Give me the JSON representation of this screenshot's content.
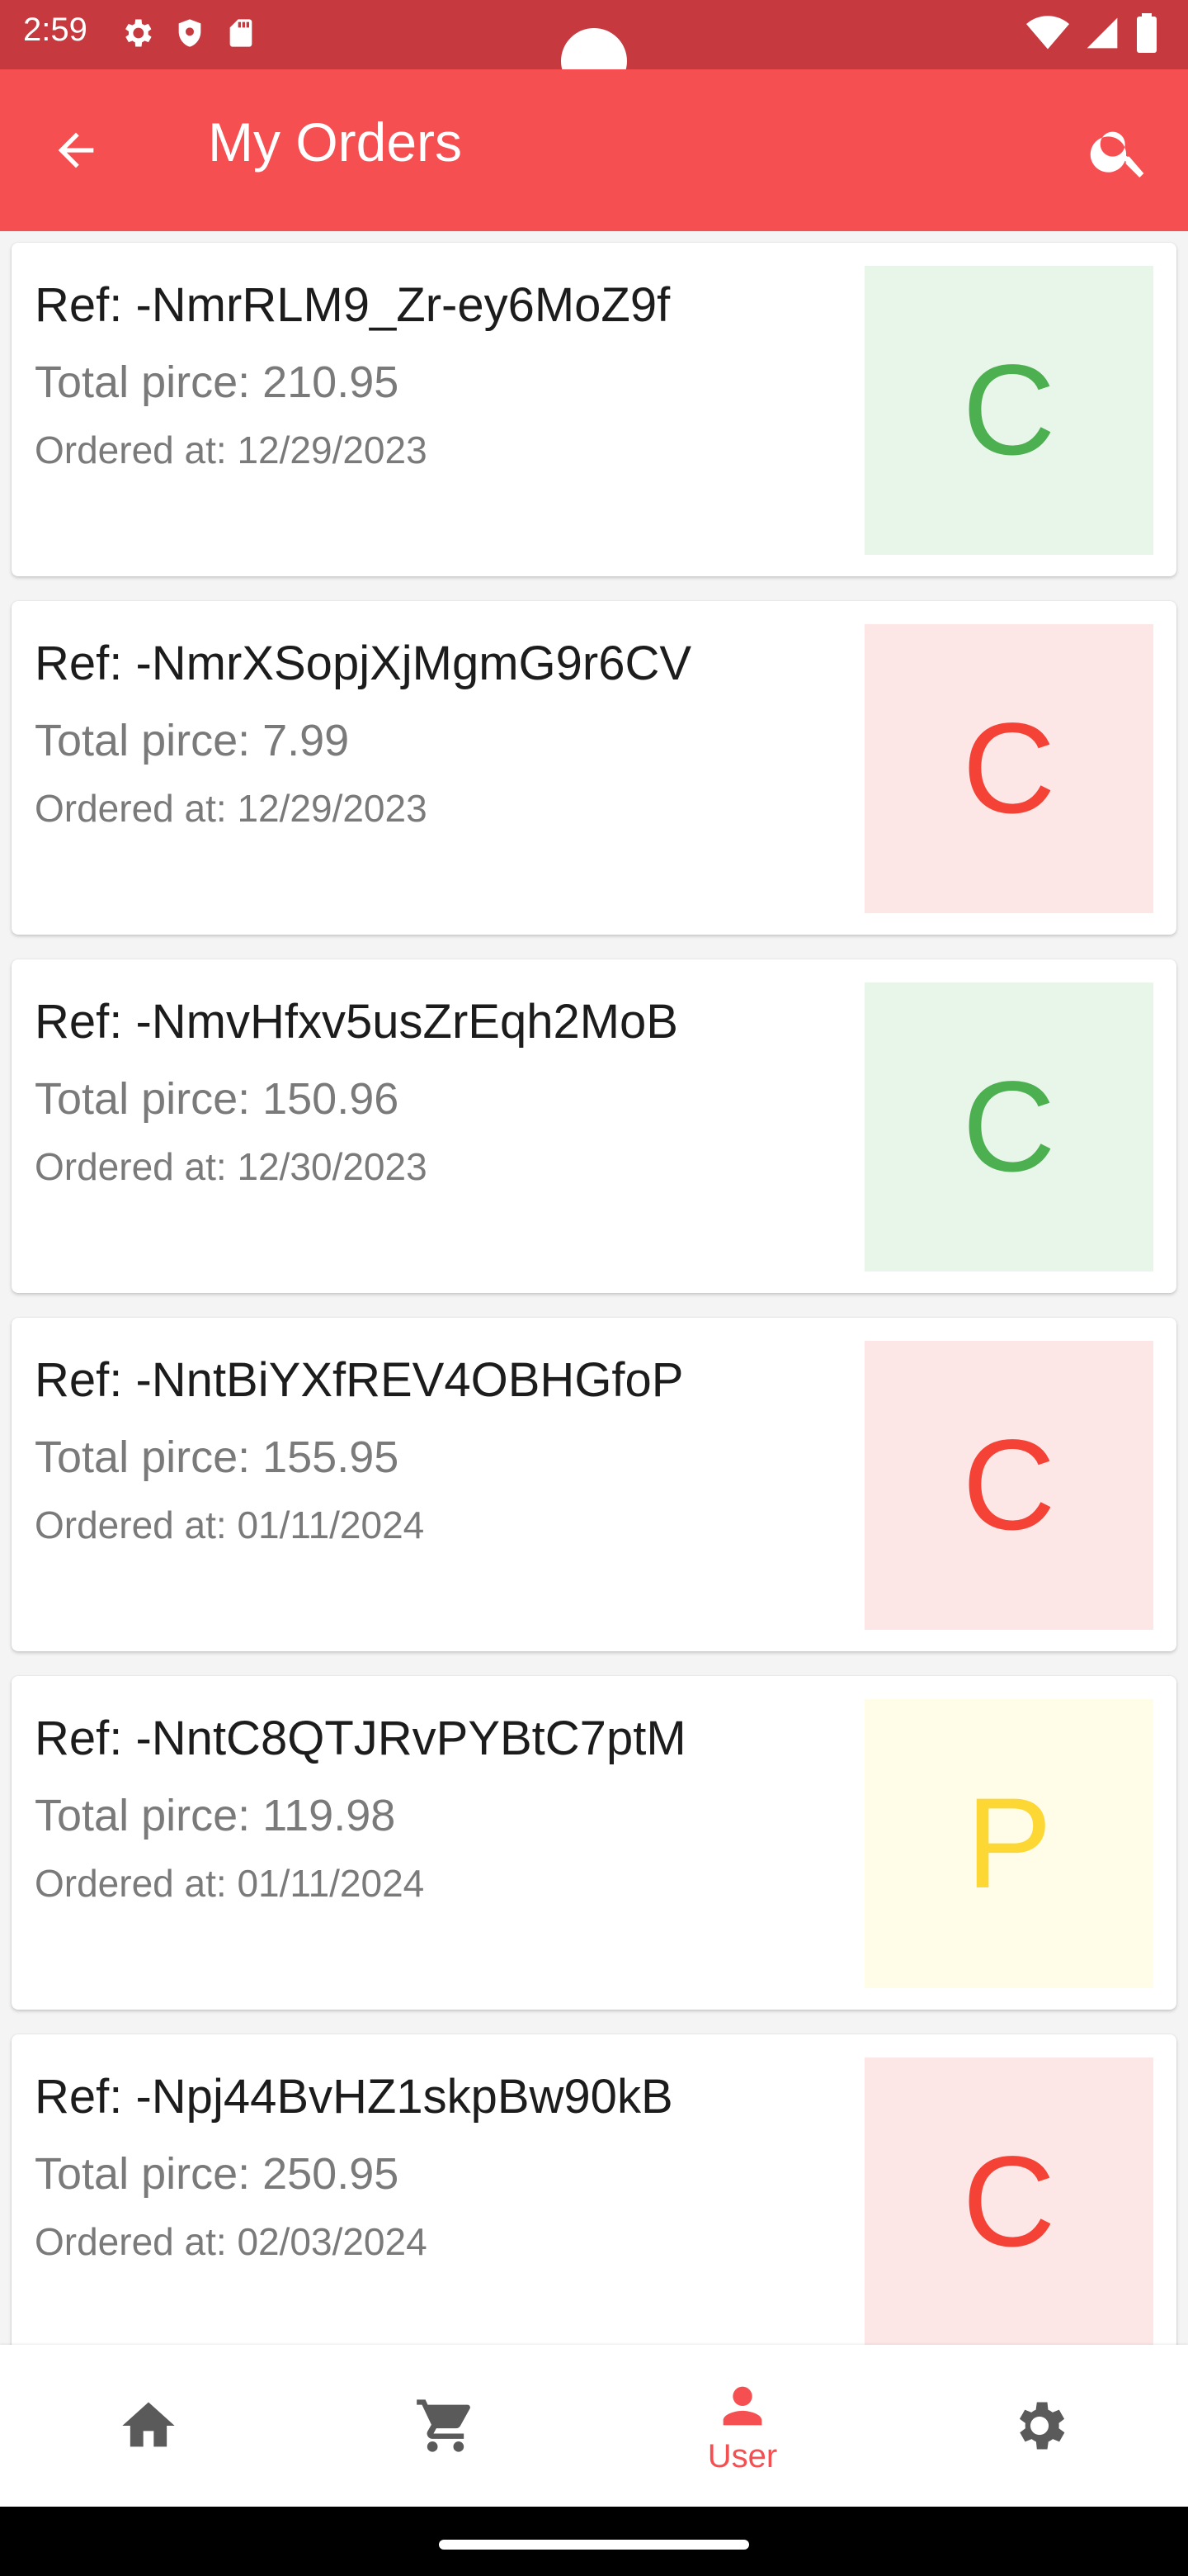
{
  "status_bar": {
    "time": "2:59"
  },
  "app_bar": {
    "title": "My Orders"
  },
  "orders": [
    {
      "ref": "Ref: -NmrRLM9_Zr-ey6MoZ9f",
      "total": "Total pirce: 210.95",
      "ordered": "Ordered at: 12/29/2023",
      "status_letter": "C",
      "bg": "#e8f5e9",
      "fg": "#4caf50"
    },
    {
      "ref": "Ref: -NmrXSopjXjMgmG9r6CV",
      "total": "Total pirce: 7.99",
      "ordered": "Ordered at: 12/29/2023",
      "status_letter": "C",
      "bg": "#fde6e6",
      "fg": "#f44336"
    },
    {
      "ref": "Ref: -NmvHfxv5usZrEqh2MoB",
      "total": "Total pirce: 150.96",
      "ordered": "Ordered at: 12/30/2023",
      "status_letter": "C",
      "bg": "#e8f5e9",
      "fg": "#4caf50"
    },
    {
      "ref": "Ref: -NntBiYXfREV4OBHGfoP",
      "total": "Total pirce: 155.95",
      "ordered": "Ordered at: 01/11/2024",
      "status_letter": "C",
      "bg": "#fde6e6",
      "fg": "#f44336"
    },
    {
      "ref": "Ref: -NntC8QTJRvPYBtC7ptM",
      "total": "Total pirce: 119.98",
      "ordered": "Ordered at: 01/11/2024",
      "status_letter": "P",
      "bg": "#fffde7",
      "fg": "#fdd835"
    },
    {
      "ref": "Ref: -Npj44BvHZ1skpBw90kB",
      "total": "Total pirce: 250.95",
      "ordered": "Ordered at: 02/03/2024",
      "status_letter": "C",
      "bg": "#fde6e6",
      "fg": "#f44336"
    }
  ],
  "bottom_nav": {
    "items": [
      {
        "icon": "home-icon",
        "label": ""
      },
      {
        "icon": "cart-icon",
        "label": ""
      },
      {
        "icon": "user-icon",
        "label": "User"
      },
      {
        "icon": "settings-icon",
        "label": ""
      }
    ]
  },
  "colors": {
    "primary": "#f64f52",
    "status_bar": "#c6393e"
  }
}
